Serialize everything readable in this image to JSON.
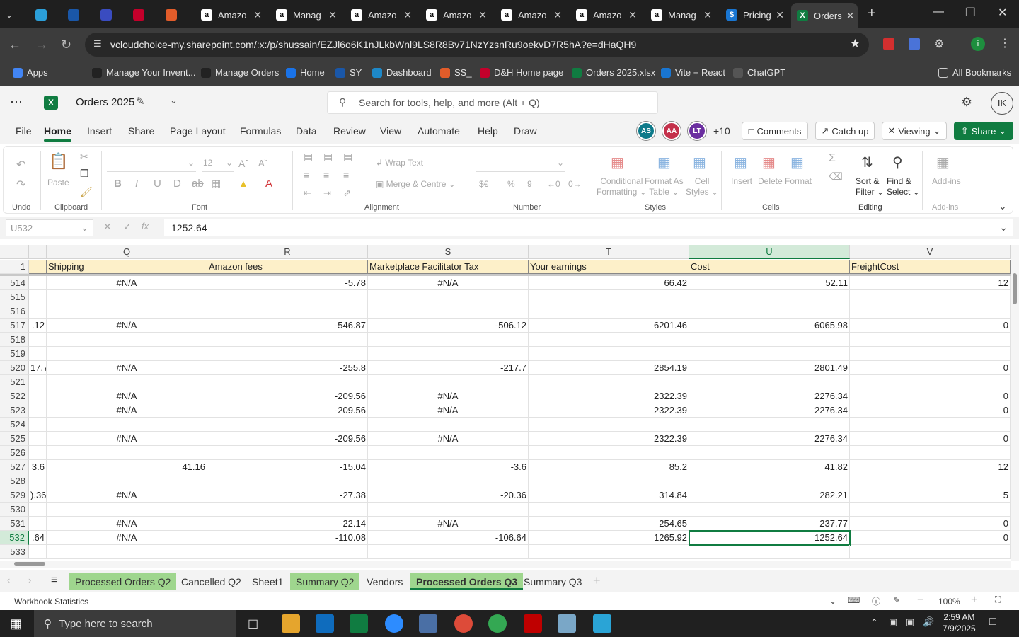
{
  "browser": {
    "tabs": [
      {
        "label": "",
        "icon": "github-icon"
      },
      {
        "label": "",
        "icon": "ec-icon"
      },
      {
        "label": "",
        "icon": "tw-icon"
      },
      {
        "label": "",
        "icon": "dh-icon"
      },
      {
        "label": "",
        "icon": "ss-icon"
      },
      {
        "label": "Amazo",
        "icon": "amazon-icon"
      },
      {
        "label": "Manag",
        "icon": "amazon-icon"
      },
      {
        "label": "Amazo",
        "icon": "amazon-icon"
      },
      {
        "label": "Amazo",
        "icon": "amazon-icon"
      },
      {
        "label": "Amazo",
        "icon": "amazon-icon"
      },
      {
        "label": "Amazo",
        "icon": "amazon-icon"
      },
      {
        "label": "Manag",
        "icon": "amazon-icon"
      },
      {
        "label": "Pricing",
        "icon": "dollar-icon"
      },
      {
        "label": "Orders",
        "icon": "excel-icon"
      }
    ],
    "url": "vcloudchoice-my.sharepoint.com/:x:/p/shussain/EZJl6o6K1nJLkbWnl9LS8R8Bv71NzYzsnRu9oekvD7R5hA?e=dHaQH9",
    "bookmarks": [
      "Apps",
      "Manage Your Invent...",
      "Manage Orders",
      "Home",
      "SY",
      "Dashboard",
      "SS_",
      "D&H Home page",
      "Orders 2025.xlsx",
      "Vite + React",
      "ChatGPT"
    ],
    "all_bookmarks": "All Bookmarks"
  },
  "excel": {
    "title": "Orders 2025",
    "search_placeholder": "Search for tools, help, and more (Alt + Q)",
    "user_initials": "IK",
    "menu": [
      "File",
      "Home",
      "Insert",
      "Share",
      "Page Layout",
      "Formulas",
      "Data",
      "Review",
      "View",
      "Automate",
      "Help",
      "Draw"
    ],
    "selected_menu": "Home",
    "avatars": [
      {
        "t": "AS",
        "c": "#0e7a8a"
      },
      {
        "t": "AA",
        "c": "#c4314b"
      },
      {
        "t": "LT",
        "c": "#6b2fa0"
      }
    ],
    "more_users": "+10",
    "comments": "Comments",
    "catchup": "Catch up",
    "viewing": "Viewing",
    "share": "Share",
    "ribbon": {
      "undo": "Undo",
      "paste": "Paste",
      "clipboard": "Clipboard",
      "font_size": "12",
      "font": "Font",
      "wrap": "Wrap Text",
      "merge": "Merge & Centre",
      "alignment": "Alignment",
      "number": "Number",
      "cond": "Conditional",
      "cond2": "Formatting",
      "fmt_table": "Format As",
      "fmt_table2": "Table",
      "cell_styles": "Cell",
      "cell_styles2": "Styles",
      "styles": "Styles",
      "insert": "Insert",
      "delete": "Delete",
      "format": "Format",
      "cells": "Cells",
      "sort": "Sort &",
      "sort2": "Filter",
      "find": "Find &",
      "find2": "Select",
      "editing": "Editing",
      "addins": "Add-ins",
      "addins_group": "Add-ins"
    },
    "name_box": "U532",
    "formula_value": "1252.64",
    "columns": [
      {
        "letter": "Q",
        "header": "Shipping"
      },
      {
        "letter": "R",
        "header": "Amazon fees"
      },
      {
        "letter": "S",
        "header": "Marketplace Facilitator Tax"
      },
      {
        "letter": "T",
        "header": "Your earnings"
      },
      {
        "letter": "U",
        "header": "Cost"
      },
      {
        "letter": "V",
        "header": "FreightCost"
      }
    ],
    "rows": [
      {
        "n": "514",
        "p": "",
        "q": "#N/A",
        "r": "-5.78",
        "s": "#N/A",
        "t": "66.42",
        "u": "52.11",
        "v": "12"
      },
      {
        "n": "515",
        "p": "",
        "q": "",
        "r": "",
        "s": "",
        "t": "",
        "u": "",
        "v": ""
      },
      {
        "n": "516",
        "p": "",
        "q": "",
        "r": "",
        "s": "",
        "t": "",
        "u": "",
        "v": ""
      },
      {
        "n": "517",
        "p": ".12",
        "q": "#N/A",
        "r": "-546.87",
        "s": "-506.12",
        "t": "6201.46",
        "u": "6065.98",
        "v": "0"
      },
      {
        "n": "518",
        "p": "",
        "q": "",
        "r": "",
        "s": "",
        "t": "",
        "u": "",
        "v": ""
      },
      {
        "n": "519",
        "p": "",
        "q": "",
        "r": "",
        "s": "",
        "t": "",
        "u": "",
        "v": ""
      },
      {
        "n": "520",
        "p": "17.7",
        "q": "#N/A",
        "r": "-255.8",
        "s": "-217.7",
        "t": "2854.19",
        "u": "2801.49",
        "v": "0"
      },
      {
        "n": "521",
        "p": "",
        "q": "",
        "r": "",
        "s": "",
        "t": "",
        "u": "",
        "v": ""
      },
      {
        "n": "522",
        "p": "",
        "q": "#N/A",
        "r": "-209.56",
        "s": "#N/A",
        "t": "2322.39",
        "u": "2276.34",
        "v": "0"
      },
      {
        "n": "523",
        "p": "",
        "q": "#N/A",
        "r": "-209.56",
        "s": "#N/A",
        "t": "2322.39",
        "u": "2276.34",
        "v": "0"
      },
      {
        "n": "524",
        "p": "",
        "q": "",
        "r": "",
        "s": "",
        "t": "",
        "u": "",
        "v": ""
      },
      {
        "n": "525",
        "p": "",
        "q": "#N/A",
        "r": "-209.56",
        "s": "#N/A",
        "t": "2322.39",
        "u": "2276.34",
        "v": "0"
      },
      {
        "n": "526",
        "p": "",
        "q": "",
        "r": "",
        "s": "",
        "t": "",
        "u": "",
        "v": ""
      },
      {
        "n": "527",
        "p": "3.6",
        "q": "41.16",
        "r": "-15.04",
        "s": "-3.6",
        "t": "85.2",
        "u": "41.82",
        "v": "12"
      },
      {
        "n": "528",
        "p": "",
        "q": "",
        "r": "",
        "s": "",
        "t": "",
        "u": "",
        "v": ""
      },
      {
        "n": "529",
        "p": ").36",
        "q": "#N/A",
        "r": "-27.38",
        "s": "-20.36",
        "t": "314.84",
        "u": "282.21",
        "v": "5"
      },
      {
        "n": "530",
        "p": "",
        "q": "",
        "r": "",
        "s": "",
        "t": "",
        "u": "",
        "v": ""
      },
      {
        "n": "531",
        "p": "",
        "q": "#N/A",
        "r": "-22.14",
        "s": "#N/A",
        "t": "254.65",
        "u": "237.77",
        "v": "0"
      },
      {
        "n": "532",
        "p": ".64",
        "q": "#N/A",
        "r": "-110.08",
        "s": "-106.64",
        "t": "1265.92",
        "u": "1252.64",
        "v": "0"
      },
      {
        "n": "533",
        "p": "",
        "q": "",
        "r": "",
        "s": "",
        "t": "",
        "u": "",
        "v": ""
      }
    ],
    "header_row_num": "1",
    "sheets": [
      {
        "name": "Processed Orders Q2",
        "green": true,
        "active": false
      },
      {
        "name": "Cancelled Q2",
        "green": false,
        "active": false
      },
      {
        "name": "Sheet1",
        "green": false,
        "active": false
      },
      {
        "name": "Summary Q2",
        "green": true,
        "active": false
      },
      {
        "name": "Vendors",
        "green": false,
        "active": false
      },
      {
        "name": "Processed Orders Q3",
        "green": true,
        "active": true
      },
      {
        "name": "Summary Q3",
        "green": false,
        "active": false
      }
    ],
    "status_left": "Workbook Statistics",
    "zoom": "100%"
  },
  "taskbar": {
    "search_placeholder": "Type here to search",
    "time": "2:59 AM",
    "date": "7/9/2025"
  },
  "colors": {
    "accent": "#107c41",
    "header_fill": "#fdf0c9",
    "sheet_green": "#9fd68e"
  }
}
